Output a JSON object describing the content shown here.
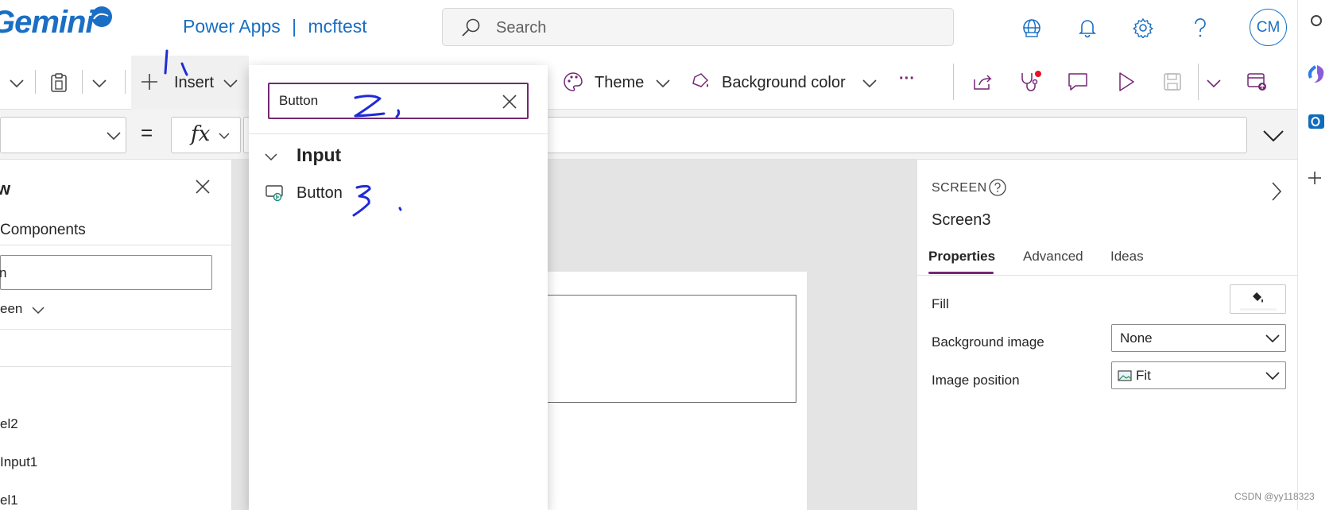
{
  "header": {
    "logo_text": "Gemini",
    "app_name": "Power Apps",
    "separator": "|",
    "environment": "mcftest",
    "search_placeholder": "Search",
    "avatar_initials": "CM"
  },
  "command_bar": {
    "insert_label": "Insert",
    "theme_label": "Theme",
    "background_color_label": "Background color",
    "more_label": "···"
  },
  "formula_bar": {
    "equals": "=",
    "fx": "fx"
  },
  "tree_view": {
    "title_fragment": "w",
    "components_tab": "Components",
    "search_value": "n",
    "screen_filter": "een",
    "items": [
      "el2",
      "Input1",
      "el1"
    ]
  },
  "insert_flyout": {
    "search_value": "Button",
    "category": "Input",
    "items": [
      {
        "label": "Button",
        "icon": "button-control-icon"
      }
    ]
  },
  "properties_panel": {
    "type_label": "SCREEN",
    "screen_name": "Screen3",
    "tabs": [
      "Properties",
      "Advanced",
      "Ideas"
    ],
    "fill_label": "Fill",
    "background_image_label": "Background image",
    "background_image_value": "None",
    "image_position_label": "Image position",
    "image_position_value": "Fit"
  },
  "annotations": [
    "1",
    "2",
    "3"
  ],
  "watermark": "CSDN @yy118323",
  "colors": {
    "brand_blue": "#1a6fc4",
    "accent_purple": "#742774",
    "annotation_blue": "#1f2bd6"
  }
}
